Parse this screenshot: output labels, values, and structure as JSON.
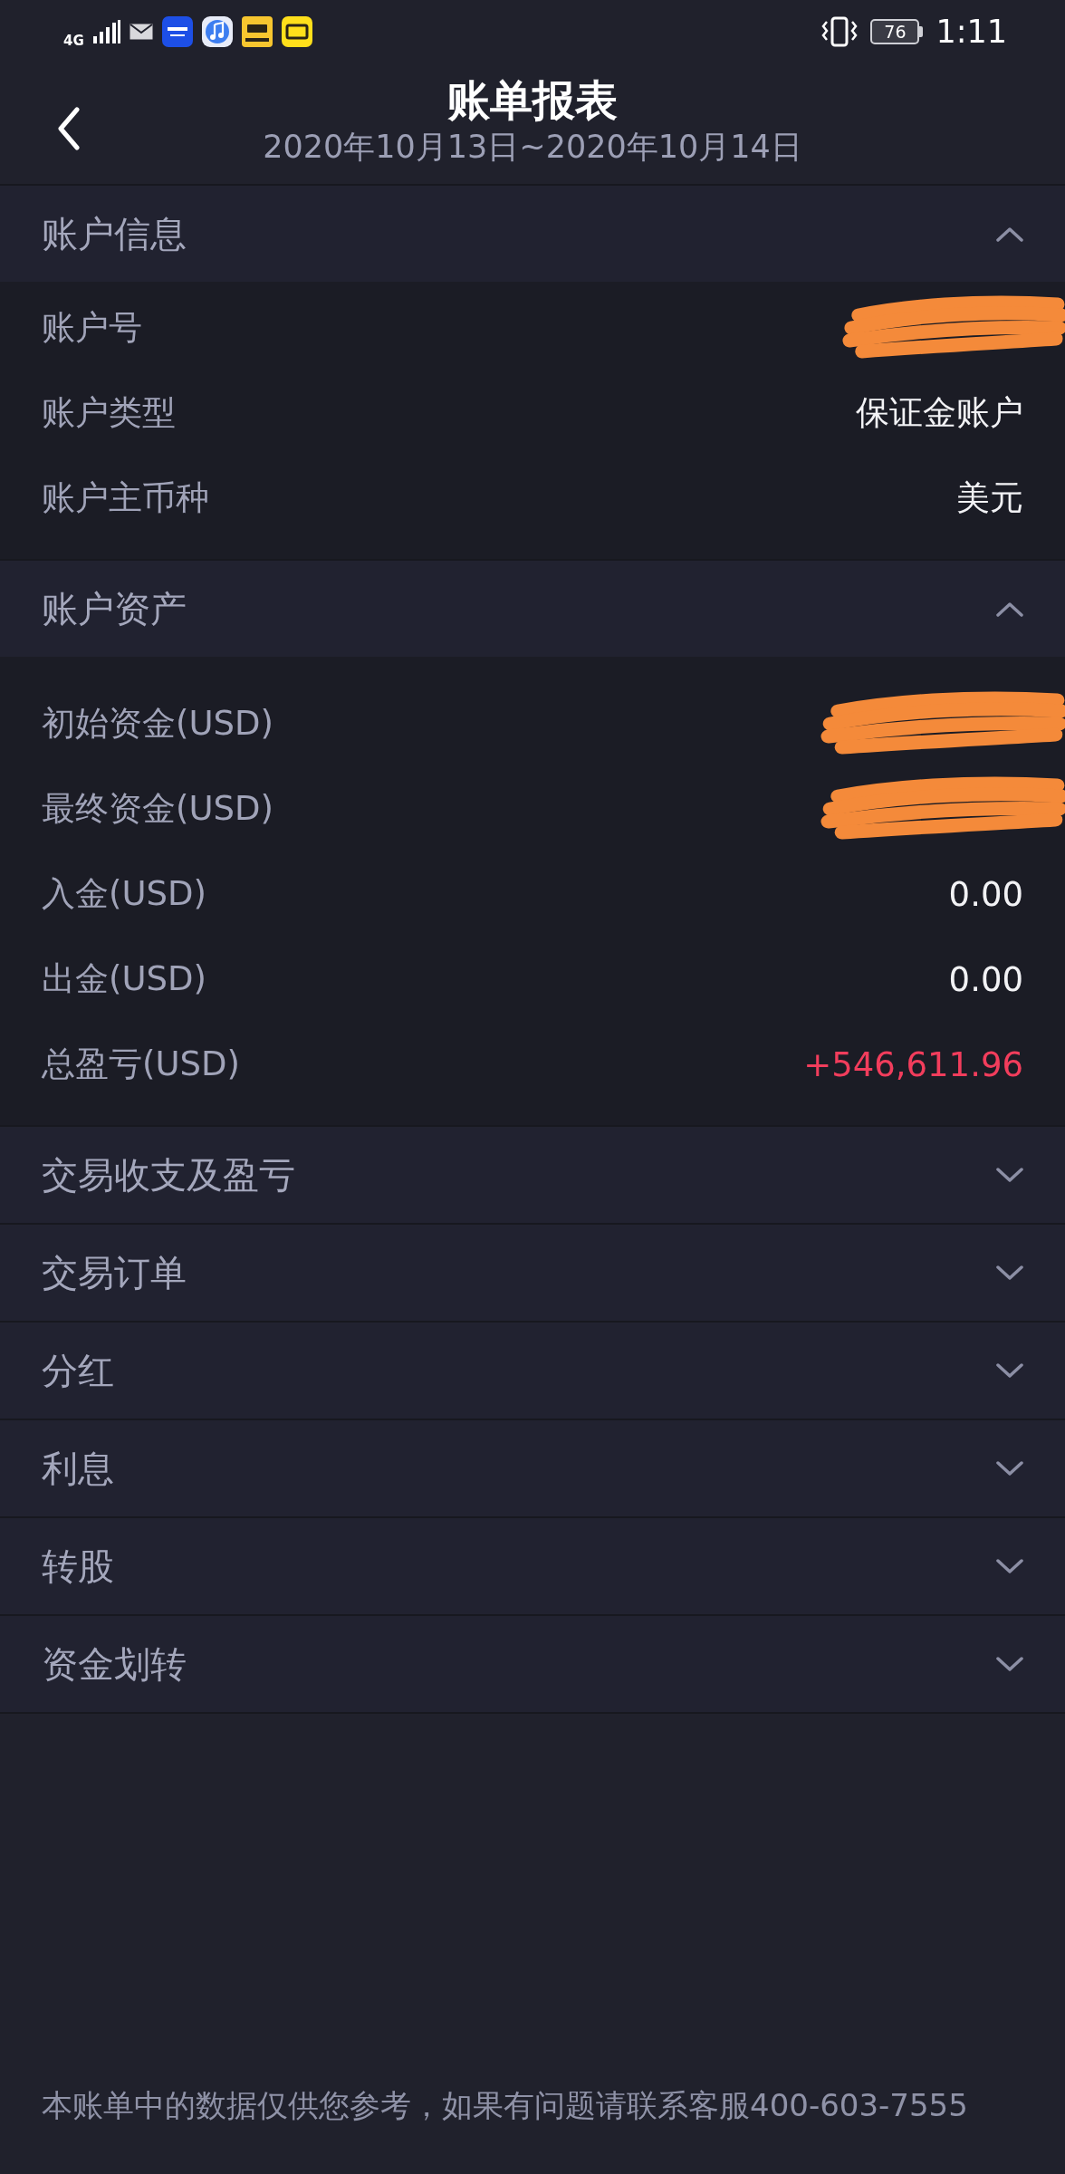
{
  "status_bar": {
    "network": "4G",
    "battery": "76",
    "time": "1:11"
  },
  "header": {
    "title": "账单报表",
    "subtitle": "2020年10月13日~2020年10月14日"
  },
  "sections": [
    {
      "title": "账户信息",
      "expanded": true,
      "rows": [
        {
          "label": "账户号",
          "redacted": true
        },
        {
          "label": "账户类型",
          "value": "保证金账户",
          "redacted": false,
          "color": "#f2f2f5"
        },
        {
          "label": "账户主币种",
          "value": "美元",
          "redacted": false,
          "color": "#f2f2f5"
        }
      ]
    },
    {
      "title": "账户资产",
      "expanded": true,
      "rows": [
        {
          "label": "初始资金(USD)",
          "redacted": true
        },
        {
          "label": "最终资金(USD)",
          "redacted": true
        },
        {
          "label": "入金(USD)",
          "value": "0.00",
          "redacted": false,
          "color": "#f2f2f5"
        },
        {
          "label": "出金(USD)",
          "value": "0.00",
          "redacted": false,
          "color": "#f2f2f5"
        },
        {
          "label": "总盈亏(USD)",
          "value": "+546,611.96",
          "redacted": false,
          "color": "#f23d5c"
        }
      ]
    },
    {
      "title": "交易收支及盈亏",
      "expanded": false
    },
    {
      "title": "交易订单",
      "expanded": false
    },
    {
      "title": "分红",
      "expanded": false
    },
    {
      "title": "利息",
      "expanded": false
    },
    {
      "title": "转股",
      "expanded": false
    },
    {
      "title": "资金划转",
      "expanded": false
    }
  ],
  "footer": {
    "note": "本账单中的数据仅供您参考，如果有问题请联系客服400-603-7555"
  }
}
